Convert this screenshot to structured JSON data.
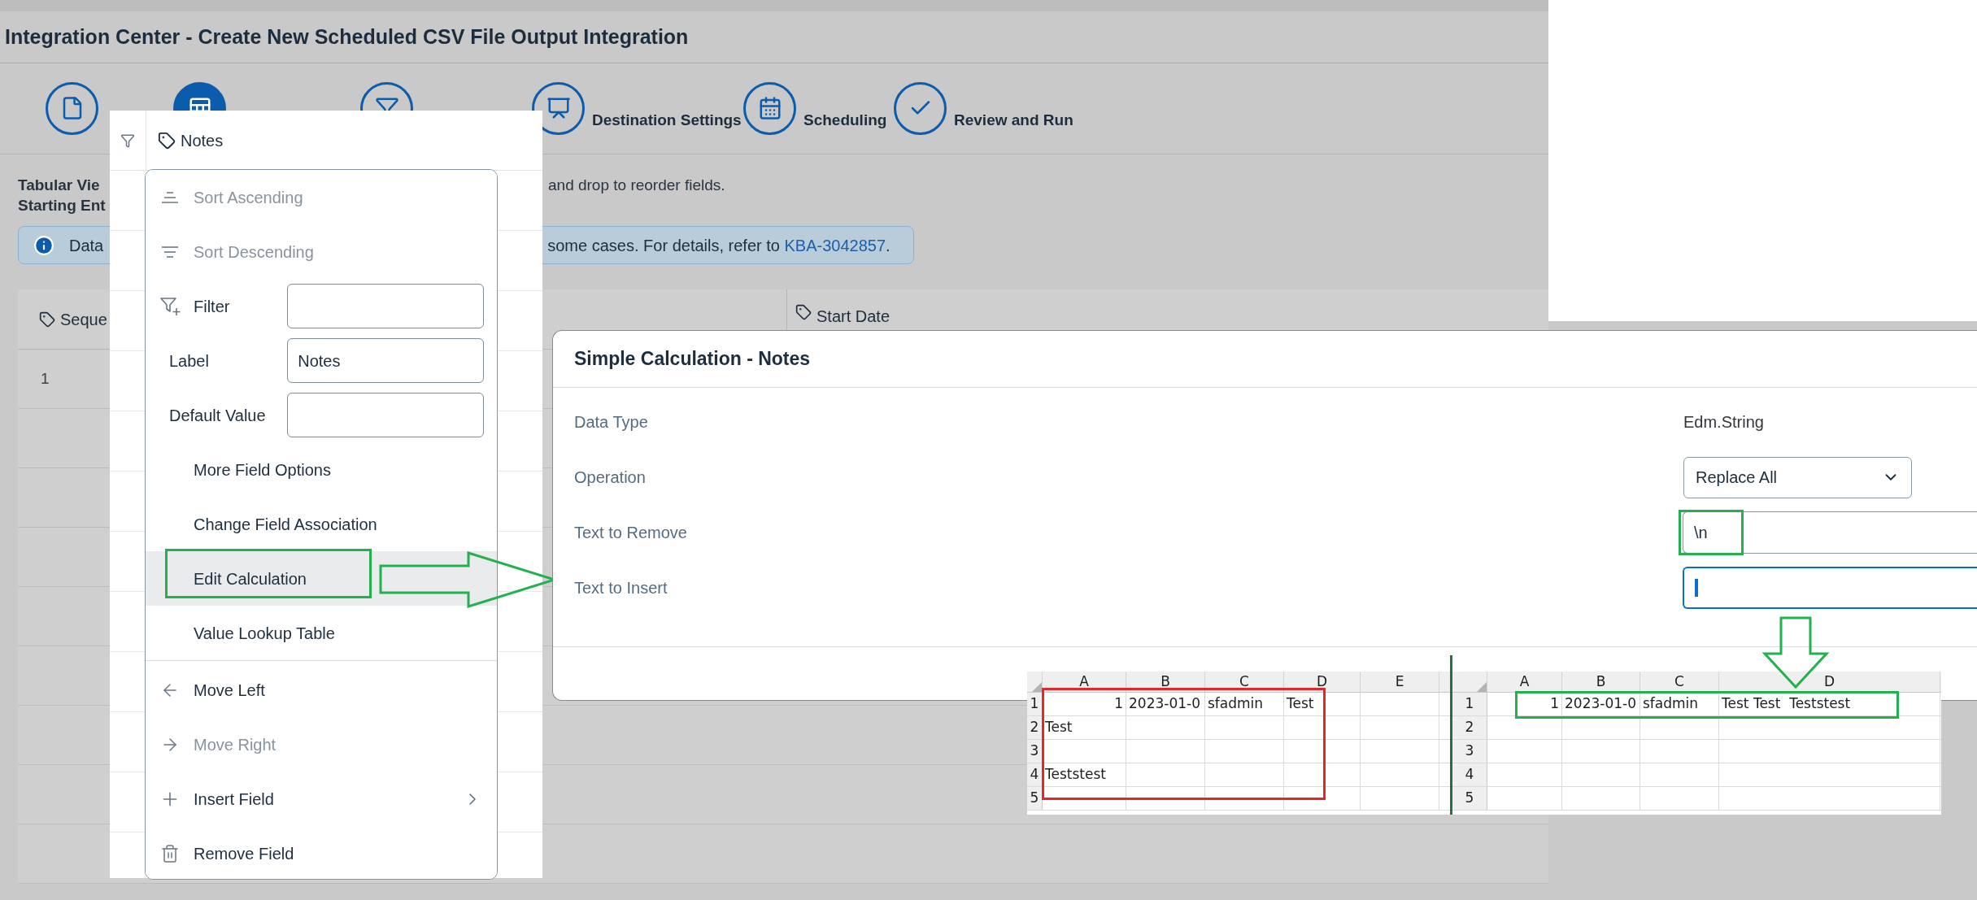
{
  "page": {
    "title": "Integration Center - Create New Scheduled CSV File Output Integration",
    "steps": [
      {
        "selected": false
      },
      {
        "selected": true
      },
      {
        "selected": false
      },
      {
        "label": "Destination Settings",
        "selected": false
      },
      {
        "label": "Scheduling",
        "selected": false
      },
      {
        "label": "Review and Run",
        "selected": false
      }
    ],
    "intro": {
      "line_1": "Tabular Vie",
      "line_1_end": "and drop to reorder fields.",
      "line_2": "Starting Ent"
    },
    "info": {
      "text_start": "Data",
      "text_end": "some cases. For details, refer to",
      "link": "KBA-3042857",
      "text_after": "."
    },
    "table": {
      "columns": [
        "Seque",
        "Start Date"
      ],
      "rows": [
        [
          "1"
        ]
      ]
    }
  },
  "column_menu": {
    "header": "Notes",
    "items": [
      {
        "kind": "action",
        "label": "Sort Ascending",
        "disabled": true,
        "selected": false
      },
      {
        "kind": "action",
        "label": "Sort Descending",
        "disabled": true,
        "selected": false
      },
      {
        "kind": "field",
        "label": "Filter"
      },
      {
        "kind": "field",
        "label": "Label",
        "value": "Notes"
      },
      {
        "kind": "field",
        "label": "Default Value"
      },
      {
        "kind": "action",
        "label": "More Field Options",
        "disabled": false,
        "selected": false
      },
      {
        "kind": "action",
        "label": "Change Field Association",
        "disabled": false,
        "selected": false
      },
      {
        "kind": "action",
        "label": "Edit Calculation",
        "disabled": false,
        "selected": true,
        "highlighted": true
      },
      {
        "kind": "action",
        "label": "Value Lookup Table",
        "disabled": false,
        "selected": false
      },
      {
        "kind": "separator"
      },
      {
        "kind": "action",
        "label": "Move Left",
        "disabled": false,
        "selected": false
      },
      {
        "kind": "action",
        "label": "Move Right",
        "disabled": true,
        "selected": false
      },
      {
        "kind": "action",
        "label": "Insert Field",
        "disabled": false,
        "selected": false,
        "submenu": true
      },
      {
        "kind": "action",
        "label": "Remove Field",
        "disabled": false,
        "selected": false
      }
    ]
  },
  "dialog": {
    "title": "Simple Calculation - Notes",
    "rows": [
      {
        "kind": "text",
        "label": "Data Type",
        "value": "Edm.String"
      },
      {
        "kind": "select",
        "label": "Operation",
        "value": "Replace All"
      },
      {
        "kind": "input",
        "label": "Text to Remove",
        "value": "\\n",
        "highlighted": true,
        "focused": false
      },
      {
        "kind": "input",
        "label": "Text to Insert",
        "highlighted": false,
        "focused": true
      }
    ]
  },
  "sheets": [
    {
      "color": "#e3262b",
      "columns": [
        "A",
        "B",
        "C",
        "D",
        "E"
      ],
      "rows": [
        {
          "number": "1",
          "cells": [
            {
              "text": "1",
              "kind": "number"
            },
            {
              "text": "2023-01-0",
              "kind": "text"
            },
            {
              "text": "sfadmin",
              "kind": "text"
            },
            {
              "text": "Test",
              "kind": "text"
            }
          ]
        },
        {
          "number": "2",
          "cells": [
            {
              "text": "Test",
              "kind": "text"
            }
          ]
        },
        {
          "number": "3"
        },
        {
          "number": "4",
          "cells": [
            {
              "text": "Teststest",
              "kind": "text"
            }
          ]
        },
        {
          "number": "5"
        }
      ]
    },
    {
      "color": "#22b14c",
      "columns": [
        "A",
        "B",
        "C",
        "D"
      ],
      "rows": [
        {
          "number": "1",
          "cells": [
            {
              "text": "1",
              "kind": "number"
            },
            {
              "text": "2023-01-0",
              "kind": "text"
            },
            {
              "text": "sfadmin",
              "kind": "text"
            },
            {
              "text": "Test Test  Teststest",
              "kind": "text"
            }
          ]
        },
        {
          "number": "2"
        },
        {
          "number": "3"
        },
        {
          "number": "4"
        },
        {
          "number": "5"
        }
      ]
    }
  ]
}
